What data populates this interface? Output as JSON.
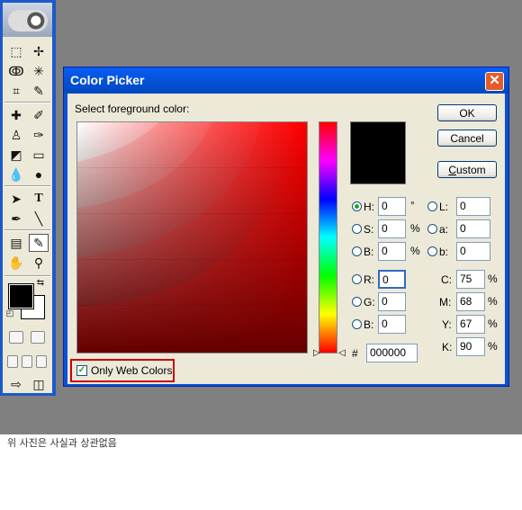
{
  "dialog": {
    "title": "Color Picker",
    "close_glyph": "✕",
    "select_label": "Select foreground color:",
    "buttons": {
      "ok": "OK",
      "cancel": "Cancel",
      "custom_u": "C",
      "custom_rest": "ustom"
    },
    "hsb": [
      {
        "label": "H:",
        "value": "0",
        "unit": "°"
      },
      {
        "label": "S:",
        "value": "0",
        "unit": "%"
      },
      {
        "label": "B:",
        "value": "0",
        "unit": "%"
      }
    ],
    "rgb": [
      {
        "label": "R:",
        "value": "0"
      },
      {
        "label": "G:",
        "value": "0"
      },
      {
        "label": "B:",
        "value": "0"
      }
    ],
    "lab": [
      {
        "label": "L:",
        "value": "0"
      },
      {
        "label": "a:",
        "value": "0"
      },
      {
        "label": "b:",
        "value": "0"
      }
    ],
    "cmyk": [
      {
        "label": "C:",
        "value": "75",
        "unit": "%"
      },
      {
        "label": "M:",
        "value": "68",
        "unit": "%"
      },
      {
        "label": "Y:",
        "value": "67",
        "unit": "%"
      },
      {
        "label": "K:",
        "value": "90",
        "unit": "%"
      }
    ],
    "hex_prefix": "#",
    "hex": "000000",
    "only_web_colors": "Only Web Colors",
    "selected_color": "#000000",
    "hue_color": "#ff0000"
  },
  "caption": "위 사진은 사실과 상관없음",
  "colors": {
    "workspace": "#808080",
    "titlebar": "#0350d4",
    "highlight": "#cc0000"
  }
}
